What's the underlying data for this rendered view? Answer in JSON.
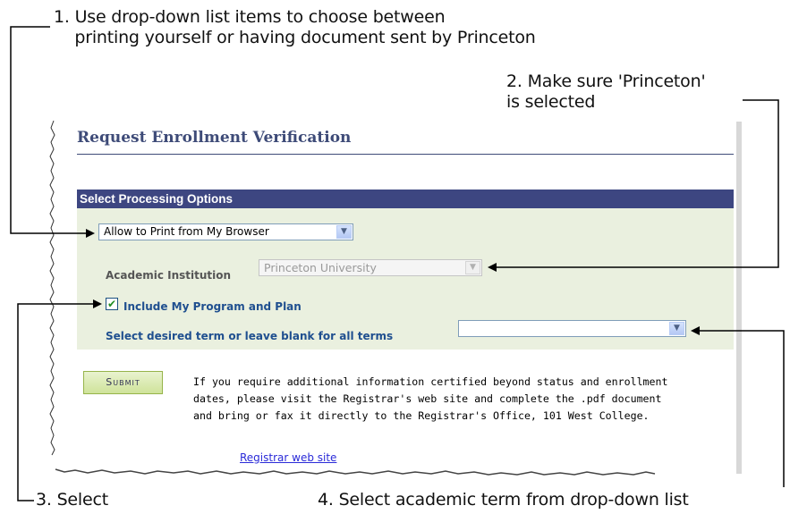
{
  "callouts": {
    "c1": "1. Use drop-down list items to choose between\n    printing yourself or having document sent by Princeton",
    "c2": "2. Make sure 'Princeton'\nis selected",
    "c3": "3. Select",
    "c4": "4. Select academic term from drop-down list"
  },
  "page": {
    "title": "Request Enrollment Verification",
    "section_header": "Select Processing Options",
    "print_option": "Allow to Print from My Browser",
    "institution_label": "Academic Institution",
    "institution_value": "Princeton University",
    "program_plan_label": "Include My Program and Plan",
    "term_label": "Select desired term or leave blank for all terms",
    "term_value": "",
    "submit_label": "Submit",
    "info_text": "If you require additional information certified beyond status and enrollment\ndates, please visit the Registrar's web site and complete the .pdf document\nand bring or fax it directly to the Registrar's Office, 101 West College.",
    "registrar_link": "Registrar web site",
    "checkbox_checked": true
  },
  "colors": {
    "title": "#3e4b78",
    "header_bg": "#3d4681",
    "section_bg": "#eaf0df",
    "link": "#2a2ad8"
  }
}
